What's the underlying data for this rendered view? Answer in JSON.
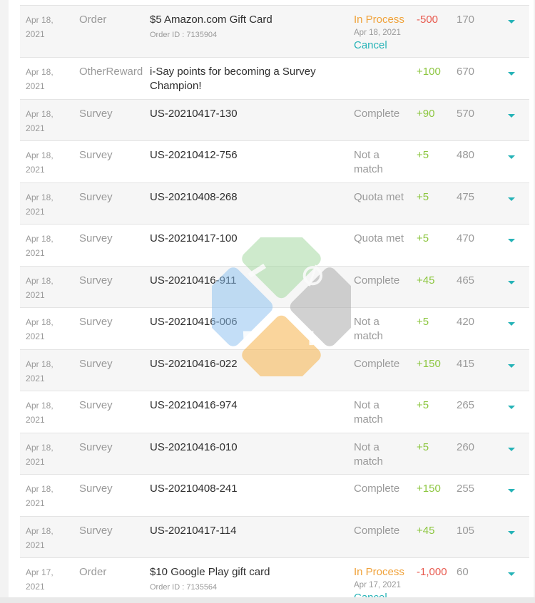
{
  "rows": [
    {
      "date_line1": "Apr 18,",
      "date_line2": "2021",
      "type": "Order",
      "desc": "$5 Amazon.com Gift Card",
      "desc_sub": "Order ID : 7135904",
      "status": "In Process",
      "status_date": "Apr 18, 2021",
      "status_action": "Cancel",
      "amount": "-500",
      "amount_sign": "neg",
      "balance": "170"
    },
    {
      "date_line1": "Apr 18,",
      "date_line2": "2021",
      "type": "OtherReward",
      "desc": "i-Say points for becoming a Survey Champion!",
      "desc_sub": "",
      "status": "",
      "status_date": "",
      "status_action": "",
      "amount": "+100",
      "amount_sign": "pos",
      "balance": "670"
    },
    {
      "date_line1": "Apr 18,",
      "date_line2": "2021",
      "type": "Survey",
      "desc": "US-20210417-130",
      "desc_sub": "",
      "status": "Complete",
      "status_date": "",
      "status_action": "",
      "amount": "+90",
      "amount_sign": "pos",
      "balance": "570"
    },
    {
      "date_line1": "Apr 18,",
      "date_line2": "2021",
      "type": "Survey",
      "desc": "US-20210412-756",
      "desc_sub": "",
      "status": "Not a match",
      "status_date": "",
      "status_action": "",
      "amount": "+5",
      "amount_sign": "pos",
      "balance": "480"
    },
    {
      "date_line1": "Apr 18,",
      "date_line2": "2021",
      "type": "Survey",
      "desc": "US-20210408-268",
      "desc_sub": "",
      "status": "Quota met",
      "status_date": "",
      "status_action": "",
      "amount": "+5",
      "amount_sign": "pos",
      "balance": "475"
    },
    {
      "date_line1": "Apr 18,",
      "date_line2": "2021",
      "type": "Survey",
      "desc": "US-20210417-100",
      "desc_sub": "",
      "status": "Quota met",
      "status_date": "",
      "status_action": "",
      "amount": "+5",
      "amount_sign": "pos",
      "balance": "470"
    },
    {
      "date_line1": "Apr 18,",
      "date_line2": "2021",
      "type": "Survey",
      "desc": "US-20210416-911",
      "desc_sub": "",
      "status": "Complete",
      "status_date": "",
      "status_action": "",
      "amount": "+45",
      "amount_sign": "pos",
      "balance": "465"
    },
    {
      "date_line1": "Apr 18,",
      "date_line2": "2021",
      "type": "Survey",
      "desc": "US-20210416-006",
      "desc_sub": "",
      "status": "Not a match",
      "status_date": "",
      "status_action": "",
      "amount": "+5",
      "amount_sign": "pos",
      "balance": "420"
    },
    {
      "date_line1": "Apr 18,",
      "date_line2": "2021",
      "type": "Survey",
      "desc": "US-20210416-022",
      "desc_sub": "",
      "status": "Complete",
      "status_date": "",
      "status_action": "",
      "amount": "+150",
      "amount_sign": "pos",
      "balance": "415"
    },
    {
      "date_line1": "Apr 18,",
      "date_line2": "2021",
      "type": "Survey",
      "desc": "US-20210416-974",
      "desc_sub": "",
      "status": "Not a match",
      "status_date": "",
      "status_action": "",
      "amount": "+5",
      "amount_sign": "pos",
      "balance": "265"
    },
    {
      "date_line1": "Apr 18,",
      "date_line2": "2021",
      "type": "Survey",
      "desc": "US-20210416-010",
      "desc_sub": "",
      "status": "Not a match",
      "status_date": "",
      "status_action": "",
      "amount": "+5",
      "amount_sign": "pos",
      "balance": "260"
    },
    {
      "date_line1": "Apr 18,",
      "date_line2": "2021",
      "type": "Survey",
      "desc": "US-20210408-241",
      "desc_sub": "",
      "status": "Complete",
      "status_date": "",
      "status_action": "",
      "amount": "+150",
      "amount_sign": "pos",
      "balance": "255"
    },
    {
      "date_line1": "Apr 18,",
      "date_line2": "2021",
      "type": "Survey",
      "desc": "US-20210417-114",
      "desc_sub": "",
      "status": "Complete",
      "status_date": "",
      "status_action": "",
      "amount": "+45",
      "amount_sign": "pos",
      "balance": "105"
    },
    {
      "date_line1": "Apr 17,",
      "date_line2": "2021",
      "type": "Order",
      "desc": "$10 Google Play gift card",
      "desc_sub": "Order ID : 7135564",
      "status": "In Process",
      "status_date": "Apr 17, 2021",
      "status_action": "Cancel",
      "amount": "-1,000",
      "amount_sign": "neg",
      "balance": "60"
    }
  ],
  "icons": {
    "row_toggle": "caret-down-icon",
    "watermark": "watermark-logo"
  },
  "colors": {
    "in_process": "#f0a23a",
    "cancel": "#26b3b7",
    "positive": "#8cc63f",
    "negative": "#e85a4f",
    "toggle": "#26b3b7"
  }
}
